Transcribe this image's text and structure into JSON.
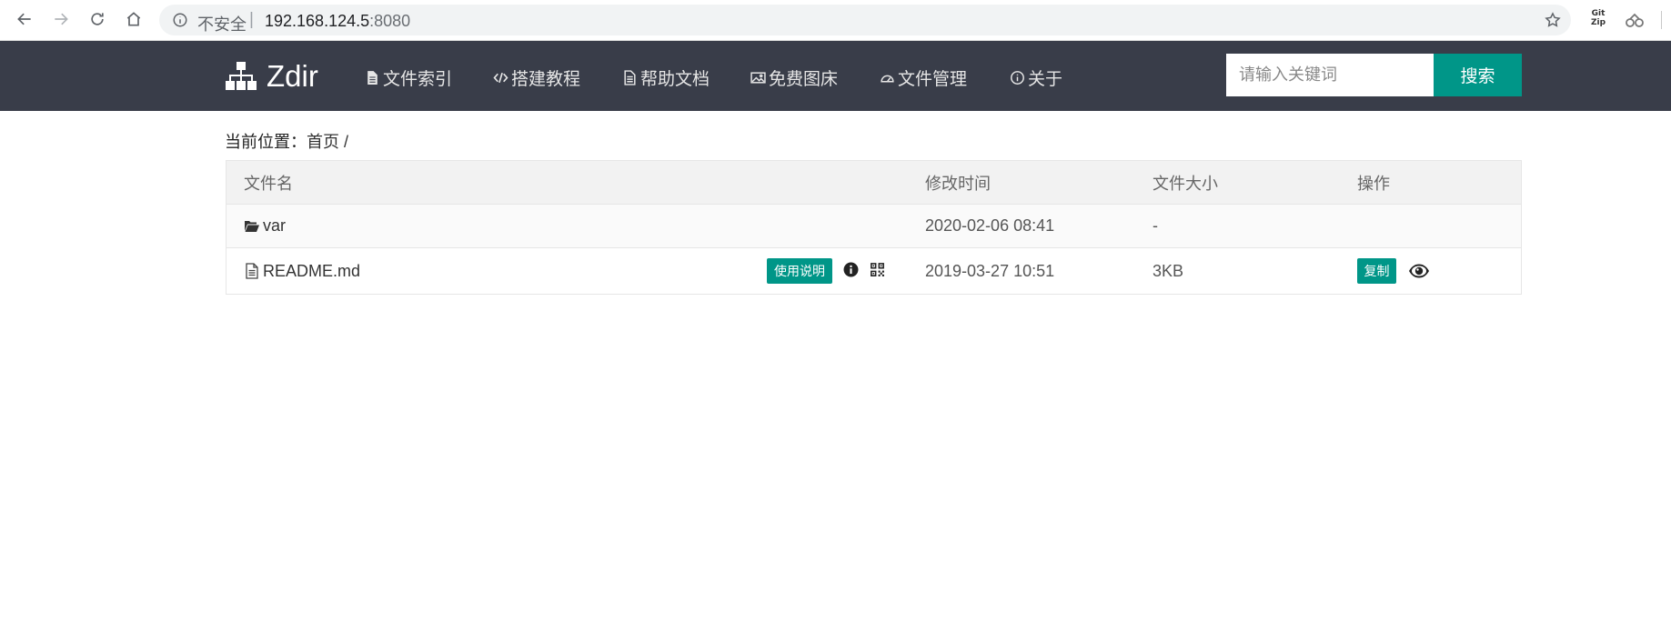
{
  "browser": {
    "security_label": "不安全",
    "separator": "|",
    "host": "192.168.124.5",
    "port": ":8080",
    "ext_gitzip_label": "Git\nZip",
    "icons": [
      "back-icon",
      "forward-icon",
      "reload-icon",
      "home-icon",
      "info-icon",
      "star-icon",
      "gitzip-extension-icon",
      "extension-icon"
    ]
  },
  "navbar": {
    "brand": "Zdir",
    "items": [
      {
        "label": "文件索引",
        "icon": "document-icon"
      },
      {
        "label": "搭建教程",
        "icon": "code-icon"
      },
      {
        "label": "帮助文档",
        "icon": "document-icon"
      },
      {
        "label": "免费图床",
        "icon": "image-icon"
      },
      {
        "label": "文件管理",
        "icon": "dashboard-icon"
      },
      {
        "label": "关于",
        "icon": "info-icon"
      }
    ],
    "search": {
      "placeholder": "请输入关键词",
      "button_label": "搜索"
    }
  },
  "breadcrumb": {
    "label": "当前位置：",
    "home": "首页",
    "separator": " /"
  },
  "table": {
    "headers": {
      "name": "文件名",
      "time": "修改时间",
      "size": "文件大小",
      "actions": "操作"
    },
    "rows": [
      {
        "name": "var",
        "type": "folder",
        "time": "2020-02-06 08:41",
        "size": "-"
      },
      {
        "name": "README.md",
        "type": "file",
        "time": "2019-03-27 10:51",
        "size": "3KB",
        "usage_label": "使用说明",
        "copy_label": "复制"
      }
    ]
  },
  "colors": {
    "navbar_bg": "#393d49",
    "accent": "#009688",
    "table_header_bg": "#f2f2f2"
  }
}
